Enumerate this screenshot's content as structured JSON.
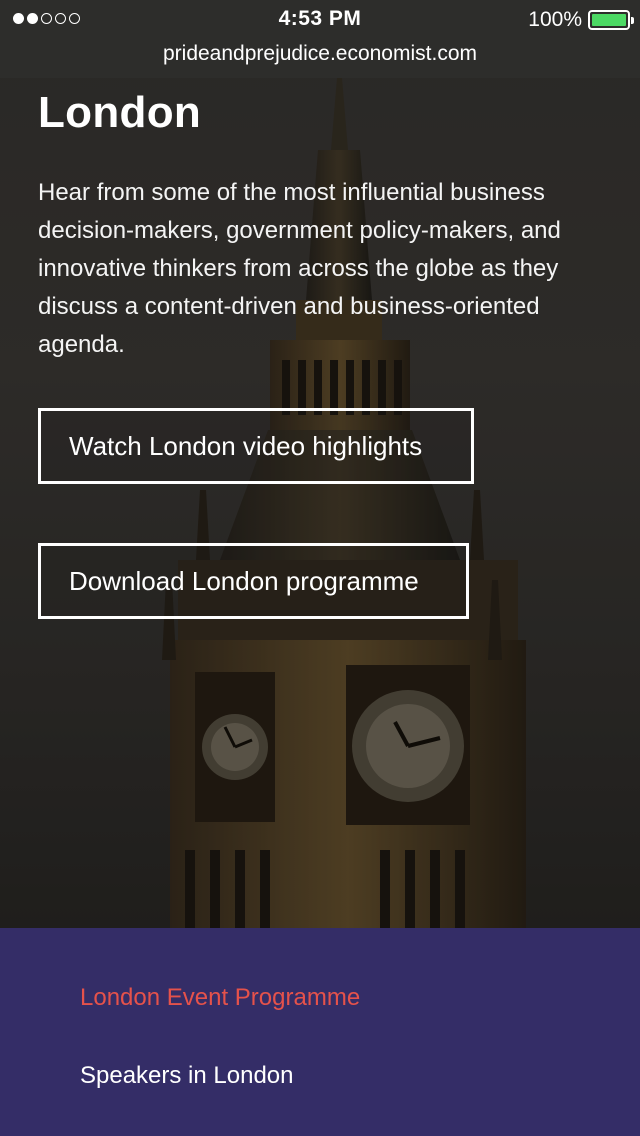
{
  "status_bar": {
    "time": "4:53 PM",
    "battery_percent": "100%",
    "battery_level": 1.0,
    "signal_bars_filled": 2,
    "signal_bars_total": 5
  },
  "browser": {
    "url": "prideandprejudice.economist.com"
  },
  "hero": {
    "title": "London",
    "intro": "Hear from some of the most influential business decision-makers, government policy-makers, and innovative thinkers from across the globe as they discuss a content-driven and business-oriented agenda.",
    "watch_button": "Watch London video highlights",
    "download_button": "Download London programme"
  },
  "footer_nav": {
    "programme_link": "London Event Programme",
    "speakers_link": "Speakers in London"
  },
  "colors": {
    "footer_background": "#342d67",
    "active_link": "#e5524b",
    "battery": "#4cd964"
  }
}
